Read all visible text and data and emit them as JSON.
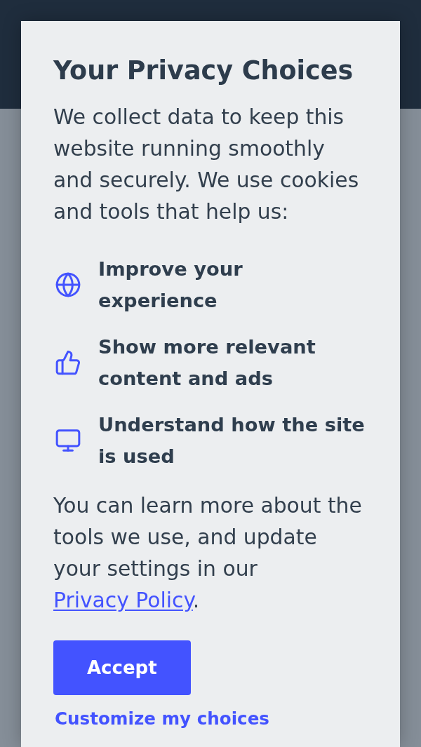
{
  "dialog": {
    "title": "Your Privacy Choices",
    "intro": "We collect data to keep this website running smoothly and securely. We use cookies and tools that help us:",
    "purposes": [
      {
        "text": "Improve your experience"
      },
      {
        "text": "Show more relevant content and ads"
      },
      {
        "text": "Understand how the site is used"
      }
    ],
    "note": {
      "text": "You can learn more about the tools we use, and update your settings in our",
      "link": "Privacy Policy",
      "end": "."
    },
    "accept_button": "Accept",
    "customize_link": "Customize my choices"
  }
}
